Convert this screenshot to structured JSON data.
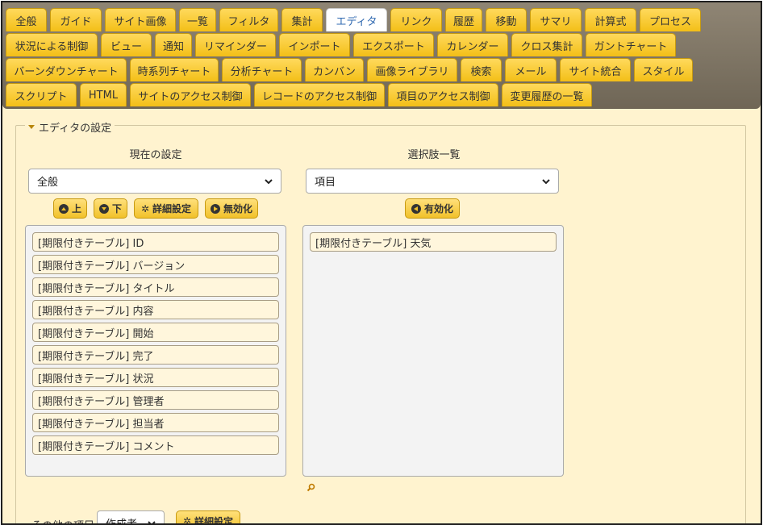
{
  "tabs": {
    "row1": [
      "全般",
      "ガイド",
      "サイト画像",
      "一覧",
      "フィルタ",
      "集計",
      "エディタ",
      "リンク",
      "履歴",
      "移動",
      "サマリ",
      "計算式",
      "プロセス"
    ],
    "row2": [
      "状況による制御",
      "ビュー",
      "通知",
      "リマインダー",
      "インポート",
      "エクスポート",
      "カレンダー",
      "クロス集計",
      "ガントチャート"
    ],
    "row3": [
      "バーンダウンチャート",
      "時系列チャート",
      "分析チャート",
      "カンバン",
      "画像ライブラリ",
      "検索",
      "メール",
      "サイト統合",
      "スタイル"
    ],
    "row4": [
      "スクリプト",
      "HTML",
      "サイトのアクセス制御",
      "レコードのアクセス制御",
      "項目のアクセス制御",
      "変更履歴の一覧"
    ],
    "active": "エディタ"
  },
  "editor": {
    "legend": "エディタの設定",
    "current": {
      "title": "現在の設定",
      "select_value": "全般",
      "btn_up": "上",
      "btn_down": "下",
      "btn_detail": "詳細設定",
      "btn_disable": "無効化",
      "items": [
        "[期限付きテーブル] ID",
        "[期限付きテーブル] バージョン",
        "[期限付きテーブル] タイトル",
        "[期限付きテーブル] 内容",
        "[期限付きテーブル] 開始",
        "[期限付きテーブル] 完了",
        "[期限付きテーブル] 状況",
        "[期限付きテーブル] 管理者",
        "[期限付きテーブル] 担当者",
        "[期限付きテーブル] コメント"
      ]
    },
    "choices": {
      "title": "選択肢一覧",
      "select_value": "項目",
      "btn_enable": "有効化",
      "items": [
        "[期限付きテーブル] 天気"
      ]
    },
    "other": {
      "label": "その他の項目",
      "select_value": "作成者",
      "btn_detail": "詳細設定"
    }
  },
  "colors": {
    "tab_bg": "#f3bf17",
    "tab_active_text": "#2f68b0",
    "panel_bg": "#fff3cf",
    "tabbar_bg": "#7a705f"
  },
  "icons": {
    "up": "arrow-up-circle-icon",
    "down": "arrow-down-circle-icon",
    "detail": "gear-icon",
    "disable": "play-circle-icon",
    "enable": "arrow-left-circle-icon",
    "search": "search-icon"
  }
}
